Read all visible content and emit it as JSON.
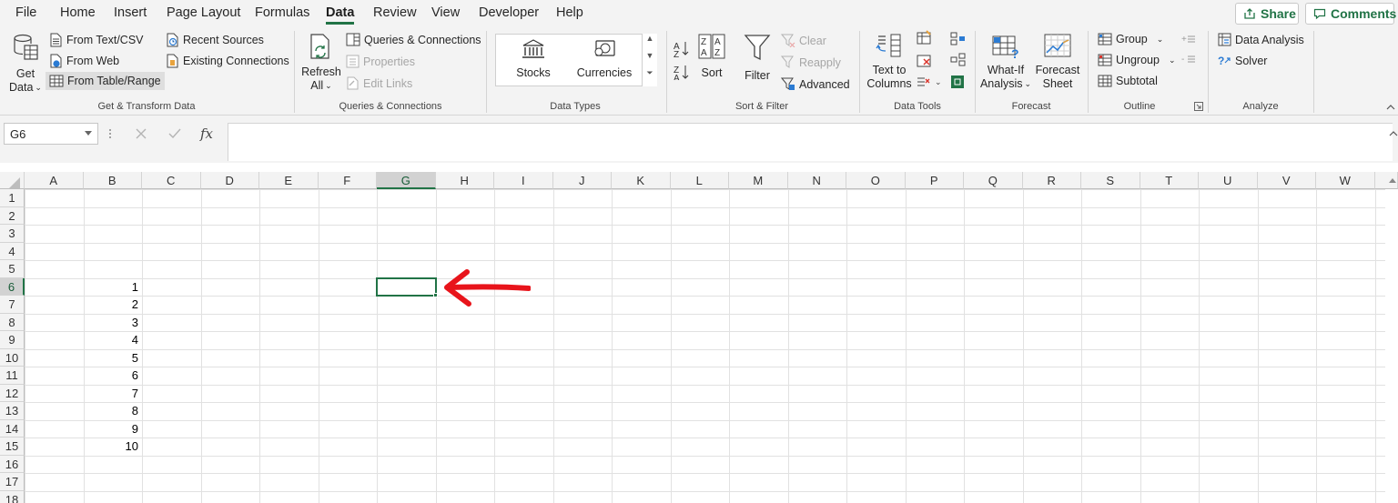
{
  "menu": {
    "tabs": [
      "File",
      "Home",
      "Insert",
      "Page Layout",
      "Formulas",
      "Data",
      "Review",
      "View",
      "Developer",
      "Help"
    ],
    "active_tab": "Data",
    "share_label": "Share",
    "comments_label": "Comments"
  },
  "ribbon": {
    "get_transform": {
      "get_data_line1": "Get",
      "get_data_line2": "Data",
      "from_text_csv": "From Text/CSV",
      "from_web": "From Web",
      "from_table_range": "From Table/Range",
      "recent_sources": "Recent Sources",
      "existing_connections": "Existing Connections",
      "group_label": "Get & Transform Data"
    },
    "queries": {
      "refresh_line1": "Refresh",
      "refresh_line2": "All",
      "queries_connections": "Queries & Connections",
      "properties": "Properties",
      "edit_links": "Edit Links",
      "group_label": "Queries & Connections"
    },
    "data_types": {
      "stocks": "Stocks",
      "currencies": "Currencies",
      "group_label": "Data Types"
    },
    "sort_filter": {
      "sort": "Sort",
      "filter": "Filter",
      "clear": "Clear",
      "reapply": "Reapply",
      "advanced": "Advanced",
      "group_label": "Sort & Filter"
    },
    "data_tools": {
      "text_to_line1": "Text to",
      "text_to_line2": "Columns",
      "group_label": "Data Tools"
    },
    "forecast": {
      "whatif_line1": "What-If",
      "whatif_line2": "Analysis",
      "forecast_line1": "Forecast",
      "forecast_line2": "Sheet",
      "group_label": "Forecast"
    },
    "outline": {
      "group": "Group",
      "ungroup": "Ungroup",
      "subtotal": "Subtotal",
      "group_label": "Outline"
    },
    "analyze": {
      "data_analysis": "Data Analysis",
      "solver": "Solver",
      "group_label": "Analyze"
    }
  },
  "formula_bar": {
    "name_box": "G6",
    "fx_label": "fx",
    "formula": ""
  },
  "sheet": {
    "columns": [
      "A",
      "B",
      "C",
      "D",
      "E",
      "F",
      "G",
      "H",
      "I",
      "J",
      "K",
      "L",
      "M",
      "N",
      "O",
      "P",
      "Q",
      "R",
      "S",
      "T",
      "U",
      "V",
      "W"
    ],
    "rows": [
      "1",
      "2",
      "3",
      "4",
      "5",
      "6",
      "7",
      "8",
      "9",
      "10",
      "11",
      "12",
      "13",
      "14",
      "15",
      "16",
      "17",
      "18"
    ],
    "selected_cell": "G6",
    "column_b_values": [
      "1",
      "2",
      "3",
      "4",
      "5",
      "6",
      "7",
      "8",
      "9",
      "10"
    ]
  },
  "colors": {
    "accent": "#217346",
    "annotation_arrow": "#e8141b"
  }
}
